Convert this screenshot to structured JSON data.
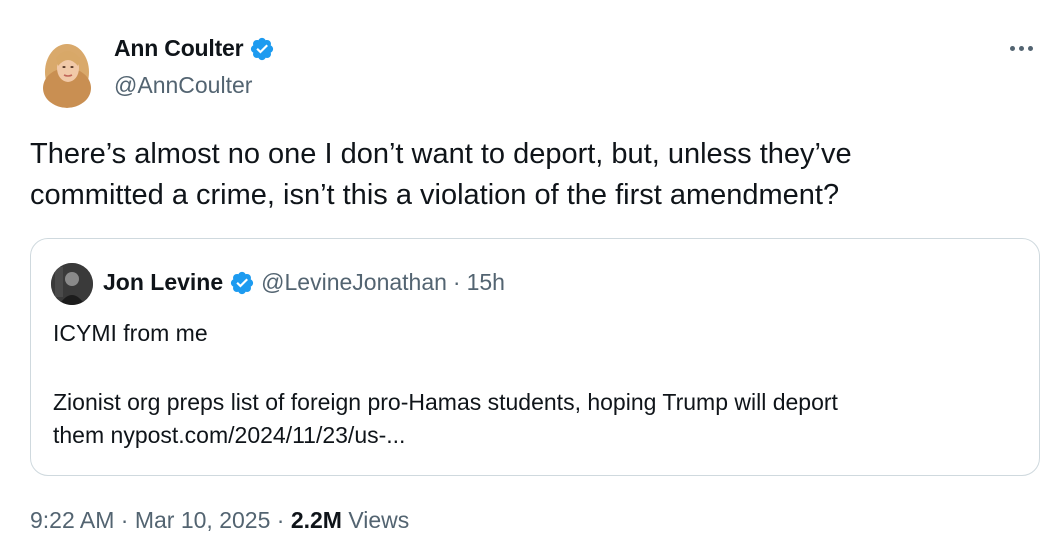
{
  "author": {
    "name": "Ann Coulter",
    "handle": "@AnnCoulter",
    "verified": true
  },
  "tweet": {
    "text_line1": "There’s almost no one I don’t want to deport, but, unless they’ve",
    "text_line2": "committed a crime, isn’t this a violation of the first amendment?"
  },
  "quote": {
    "name": "Jon Levine",
    "handle": "@LevineJonathan",
    "separator": "·",
    "time": "15h",
    "line1": "ICYMI from me",
    "line2": "Zionist org preps list of foreign pro-Hamas students, hoping Trump will deport",
    "line3_prefix": "them",
    "line3_link": "nypost.com/2024/11/23/us-..."
  },
  "meta": {
    "time": "9:22 AM",
    "separator1": "·",
    "date": "Mar 10, 2025",
    "separator2": "·",
    "views_count": "2.2M",
    "views_label": "Views"
  },
  "colors": {
    "verified_blue": "#1d9bf0",
    "text_primary": "#0f1419",
    "text_secondary": "#536471",
    "border": "#cfd9de"
  },
  "icons": {
    "verified": "verified-badge-icon",
    "more": "more-options-icon"
  }
}
